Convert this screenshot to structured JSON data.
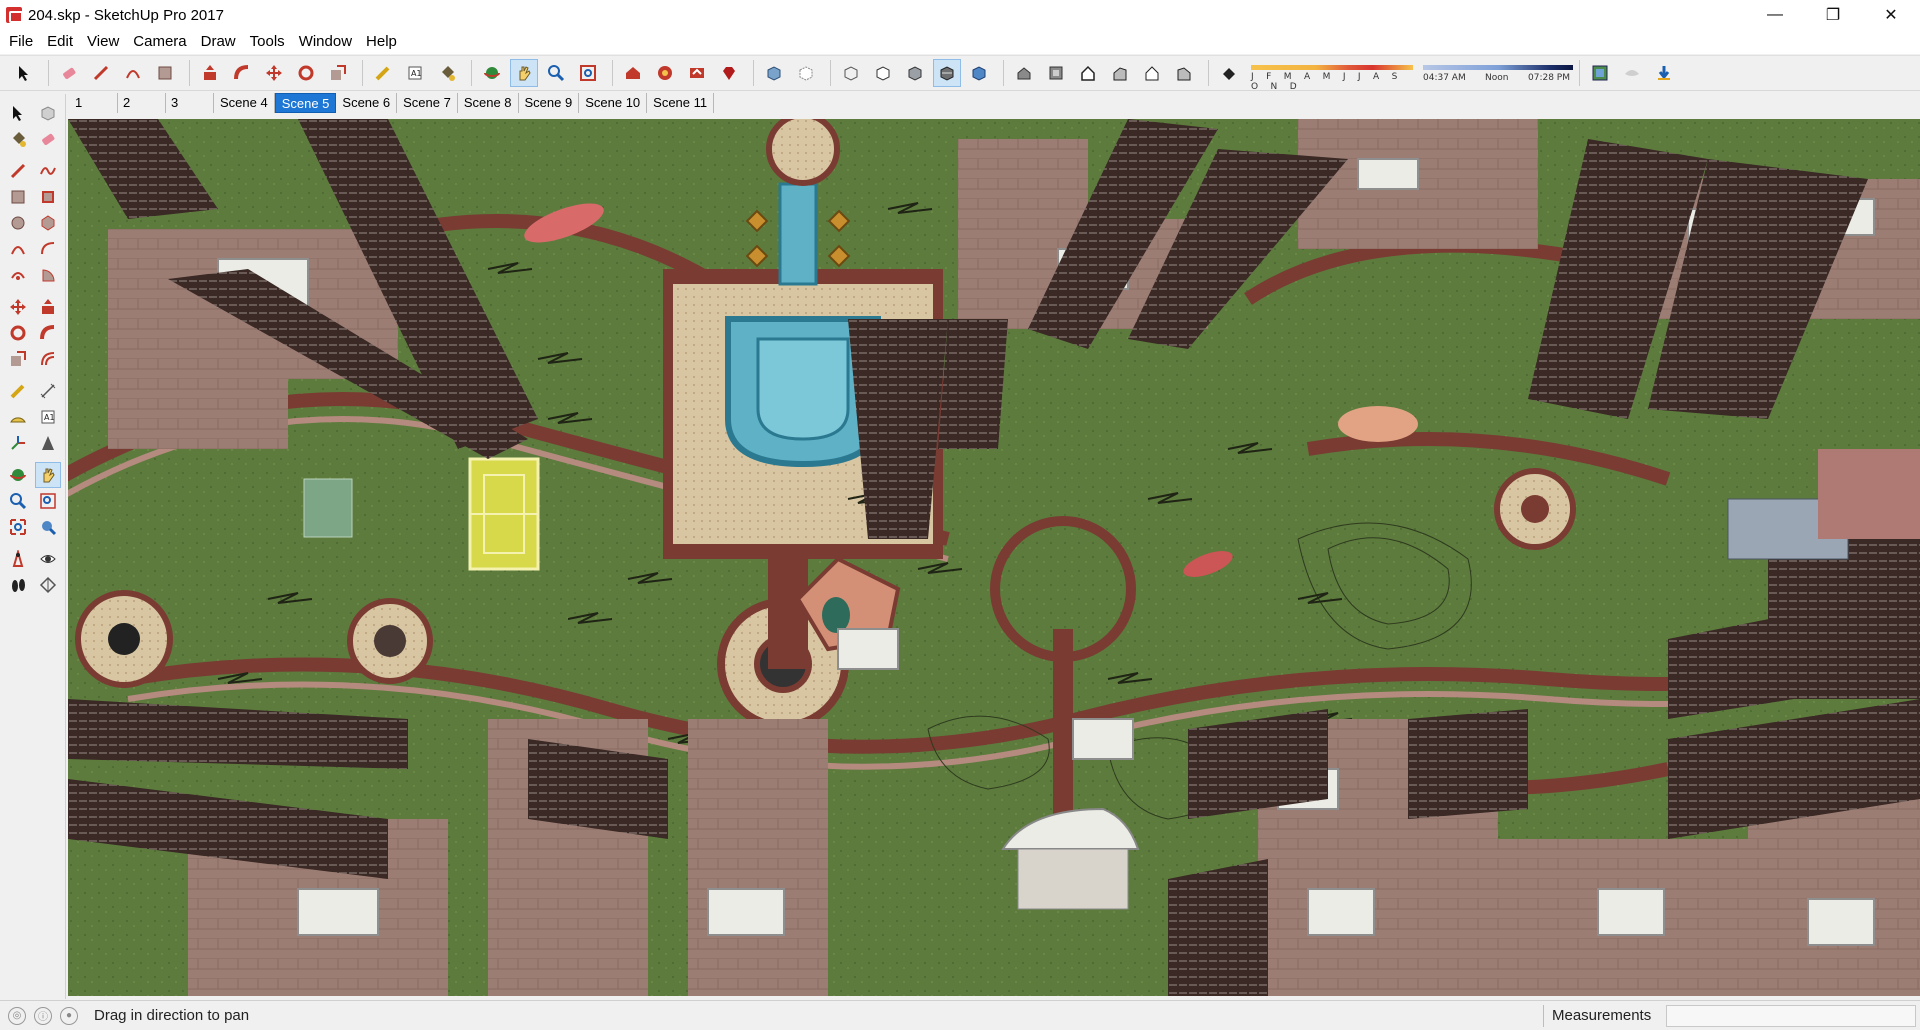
{
  "window": {
    "title": "204.skp - SketchUp Pro 2017",
    "controls": {
      "minimize": "—",
      "restore": "❐",
      "close": "✕"
    }
  },
  "menu": [
    "File",
    "Edit",
    "View",
    "Camera",
    "Draw",
    "Tools",
    "Window",
    "Help"
  ],
  "toolbar": {
    "icons": [
      "select-icon",
      "eraser-icon",
      "line-icon",
      "arc-icon",
      "rectangle-icon",
      "push-pull-icon",
      "follow-me-icon",
      "move-icon",
      "rotate-icon",
      "scale-icon",
      "tape-measure-icon",
      "text-icon",
      "paint-bucket-icon",
      "orbit-icon",
      "pan-icon",
      "zoom-icon",
      "zoom-extents-icon",
      "warehouse-icon",
      "extension-icon",
      "share-model-icon",
      "ruby-icon",
      "xray-icon",
      "back-edges-icon",
      "wireframe-icon",
      "hidden-line-icon",
      "shaded-icon",
      "textured-icon",
      "iso-view-icon",
      "top-view-icon",
      "front-view-icon",
      "right-view-icon",
      "back-view-icon",
      "left-view-icon",
      "shadows-icon",
      "location-icon",
      "fog-icon",
      "geo-icon"
    ],
    "active": "pan-icon",
    "shadow": {
      "months": "J F M A M J J A S O N D",
      "time_start": "04:37 AM",
      "time_mid": "Noon",
      "time_end": "07:28 PM"
    }
  },
  "scenes": {
    "tabs": [
      "1",
      "2",
      "3",
      "Scene 4",
      "Scene 5",
      "Scene 6",
      "Scene 7",
      "Scene 8",
      "Scene 9",
      "Scene 10",
      "Scene 11"
    ],
    "active": "Scene 5"
  },
  "status": {
    "hint": "Drag in direction to pan",
    "measurements_label": "Measurements",
    "measurements_value": ""
  },
  "colors": {
    "grass": "#5f7c3f",
    "path": "#7a3b32",
    "paving": "#9b7c74",
    "building": "#3b2a26",
    "water": "#5fb1c6",
    "accent": "#1e77d4"
  }
}
